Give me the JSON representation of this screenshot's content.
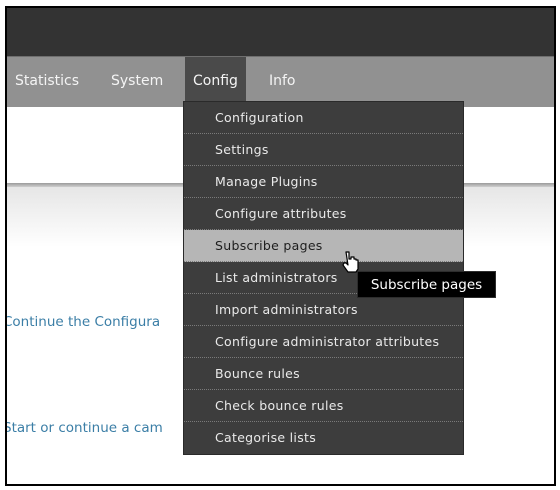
{
  "nav": {
    "items": [
      {
        "label": "Statistics",
        "active": false
      },
      {
        "label": "System",
        "active": false
      },
      {
        "label": "Config",
        "active": true
      },
      {
        "label": "Info",
        "active": false
      }
    ]
  },
  "content": {
    "link1": "Continue the Configura",
    "link2": "Start or continue a cam"
  },
  "dropdown": {
    "items": [
      "Configuration",
      "Settings",
      "Manage Plugins",
      "Configure attributes",
      "Subscribe pages",
      "List administrators",
      "Import administrators",
      "Configure administrator attributes",
      "Bounce rules",
      "Check bounce rules",
      "Categorise lists"
    ],
    "hovered": "Subscribe pages"
  },
  "tooltip": {
    "text": "Subscribe pages"
  },
  "cursor": {
    "icon": "hand-pointer-icon"
  },
  "colors": {
    "topbar": "#333333",
    "navbar": "#919191",
    "menu": "#3d3d3d",
    "link": "#3b7ea6"
  }
}
